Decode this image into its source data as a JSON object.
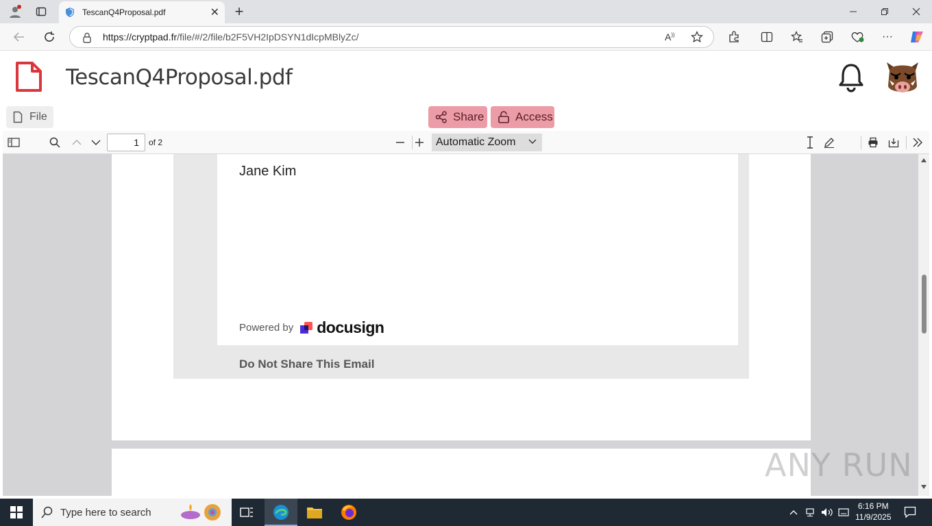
{
  "browser": {
    "tab_title": "TescanQ4Proposal.pdf",
    "url_host": "https://cryptpad.fr",
    "url_path": "/file/#/2/file/b2F5VH2IpDSYN1dIcpMBlyZc/"
  },
  "app": {
    "title": "TescanQ4Proposal.pdf",
    "file_label": "File",
    "share_label": "Share",
    "access_label": "Access"
  },
  "pdf_toolbar": {
    "page_number": "1",
    "of_pages": "of 2",
    "zoom": "Automatic Zoom"
  },
  "email": {
    "signer": "Jane Kim",
    "powered_by": "Powered by",
    "brand": "docusign",
    "footer": "Do Not Share This Email"
  },
  "watermark": "ANY RUN",
  "taskbar": {
    "search_placeholder": "Type here to search",
    "time": "6:16 PM",
    "date": "11/9/2025"
  },
  "colors": {
    "accent_pink": "#ec9ca6",
    "file_icon_red": "#d9363e",
    "taskbar": "#1f2933"
  }
}
